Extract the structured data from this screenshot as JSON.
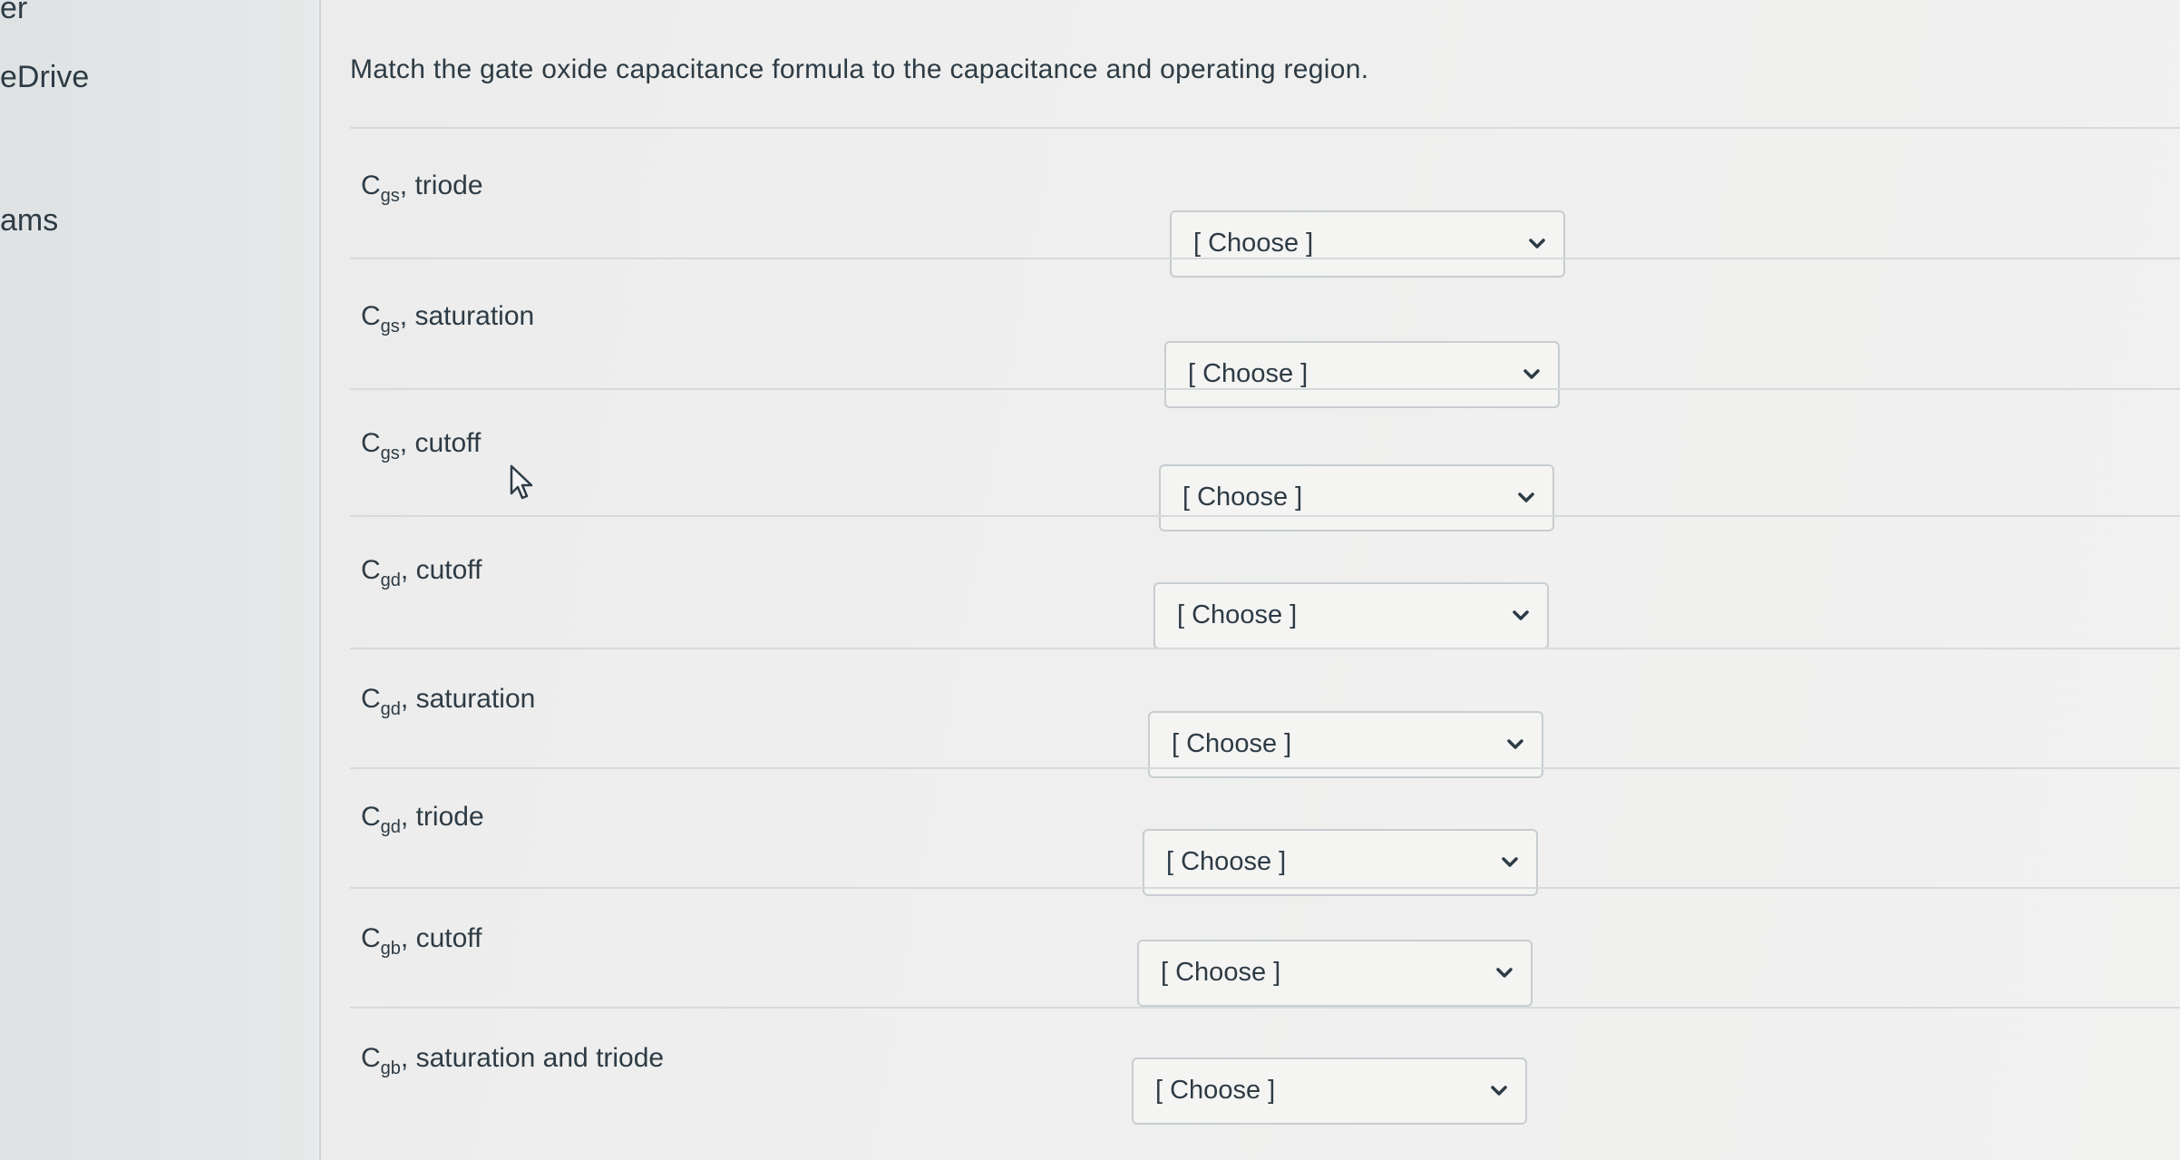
{
  "sidebar": {
    "items": [
      {
        "label": "er"
      },
      {
        "label": "eDrive"
      },
      {
        "label": "ams"
      }
    ]
  },
  "question": {
    "text": "Match the gate oxide capacitance formula to the capacitance and operating region."
  },
  "rows": [
    {
      "cap": "C",
      "sub": "gs",
      "region": ", triode",
      "select_value": "[ Choose ]"
    },
    {
      "cap": "C",
      "sub": "gs",
      "region": ", saturation",
      "select_value": "[ Choose ]"
    },
    {
      "cap": "C",
      "sub": "gs",
      "region": ", cutoff",
      "select_value": "[ Choose ]"
    },
    {
      "cap": "C",
      "sub": "gd",
      "region": ", cutoff",
      "select_value": "[ Choose ]"
    },
    {
      "cap": "C",
      "sub": "gd",
      "region": ", saturation",
      "select_value": "[ Choose ]"
    },
    {
      "cap": "C",
      "sub": "gd",
      "region": ", triode",
      "select_value": "[ Choose ]"
    },
    {
      "cap": "C",
      "sub": "gb",
      "region": ", cutoff",
      "select_value": "[ Choose ]"
    },
    {
      "cap": "C",
      "sub": "gb",
      "region": ", saturation and triode",
      "select_value": "[ Choose ]"
    }
  ],
  "icons": {
    "dropdown": "chevron-down-icon",
    "cursor": "mouse-pointer-icon"
  },
  "colors": {
    "text": "#2d3b45",
    "panel_bg": "#eeeeee",
    "border": "#c7cdd1"
  }
}
